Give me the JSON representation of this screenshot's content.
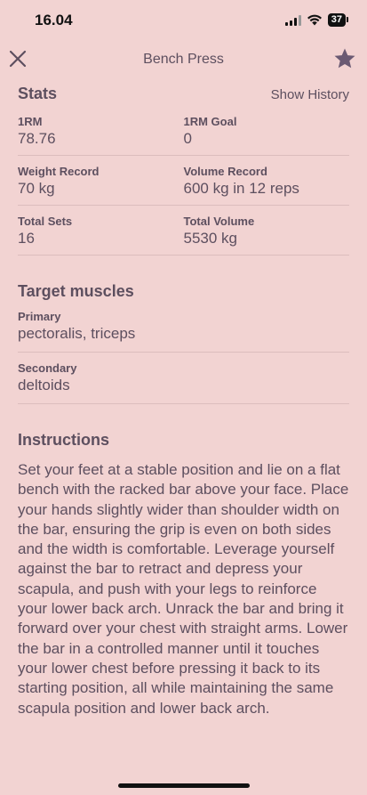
{
  "status_bar": {
    "time": "16.04",
    "battery": "37"
  },
  "nav": {
    "title": "Bench Press",
    "close_icon": "close-icon",
    "star_icon": "star-icon"
  },
  "stats": {
    "title": "Stats",
    "show_history": "Show History",
    "rows": [
      [
        {
          "label": "1RM",
          "value": "78.76"
        },
        {
          "label": "1RM Goal",
          "value": "0"
        }
      ],
      [
        {
          "label": "Weight Record",
          "value": "70 kg"
        },
        {
          "label": "Volume Record",
          "value": "600 kg in 12 reps"
        }
      ],
      [
        {
          "label": "Total Sets",
          "value": "16"
        },
        {
          "label": "Total Volume",
          "value": "5530 kg"
        }
      ]
    ]
  },
  "target_muscles": {
    "title": "Target muscles",
    "primary_label": "Primary",
    "primary_value": "pectoralis, triceps",
    "secondary_label": "Secondary",
    "secondary_value": "deltoids"
  },
  "instructions": {
    "title": "Instructions",
    "text": "Set your feet at a stable position and lie on a flat bench with the racked bar above your face. Place your hands slightly wider than shoulder width on the bar, ensuring the grip is even on both sides and the width is comfortable. Leverage yourself against the bar to retract and depress your scapula, and push with your legs to reinforce your lower back arch. Unrack the bar and bring it forward over your chest with straight arms. Lower the bar in a controlled manner until it touches your lower chest before pressing it back to its starting position, all while maintaining the same scapula position and lower back arch."
  }
}
